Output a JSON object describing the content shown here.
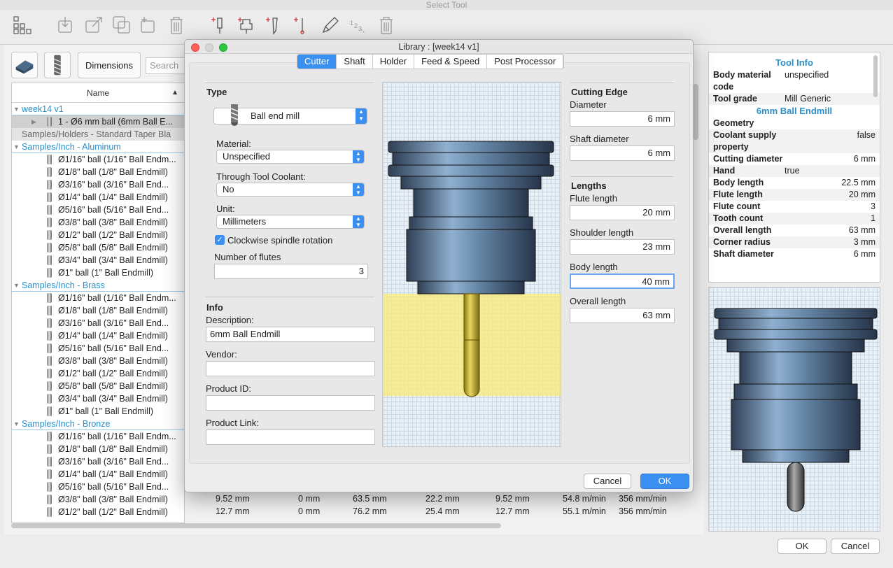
{
  "window_title": "Select Tool",
  "toolbar": {
    "icons": [
      "tool-library-icon",
      "import-icon",
      "export-icon",
      "copy-icon",
      "new-icon",
      "delete-icon",
      "new-mill-tool-icon",
      "new-holder-icon",
      "new-turning-tool-icon",
      "new-probe-icon",
      "edit-icon",
      "renumber-icon",
      "delete-tool-icon"
    ]
  },
  "left": {
    "dimensions_label": "Dimensions",
    "search_placeholder": "Search",
    "name_header": "Name",
    "tree": [
      {
        "t": "g",
        "label": "week14 v1"
      },
      {
        "t": "sel",
        "label": "1 - Ø6 mm ball (6mm Ball E..."
      },
      {
        "t": "sub",
        "label": "Samples/Holders - Standard Taper Bla"
      },
      {
        "t": "g",
        "label": "Samples/Inch - Aluminum"
      },
      {
        "t": "i",
        "label": "Ø1/16\" ball (1/16\" Ball Endm..."
      },
      {
        "t": "i",
        "label": "Ø1/8\" ball (1/8\" Ball Endmill)"
      },
      {
        "t": "i",
        "label": "Ø3/16\" ball (3/16\" Ball End..."
      },
      {
        "t": "i",
        "label": "Ø1/4\" ball (1/4\" Ball Endmill)"
      },
      {
        "t": "i",
        "label": "Ø5/16\" ball (5/16\" Ball End..."
      },
      {
        "t": "i",
        "label": "Ø3/8\" ball (3/8\" Ball Endmill)"
      },
      {
        "t": "i",
        "label": "Ø1/2\" ball (1/2\" Ball Endmill)"
      },
      {
        "t": "i",
        "label": "Ø5/8\" ball (5/8\" Ball Endmill)"
      },
      {
        "t": "i",
        "label": "Ø3/4\" ball (3/4\" Ball Endmill)"
      },
      {
        "t": "i",
        "label": "Ø1\" ball (1\" Ball Endmill)"
      },
      {
        "t": "g",
        "label": "Samples/Inch - Brass"
      },
      {
        "t": "i",
        "label": "Ø1/16\" ball (1/16\" Ball Endm..."
      },
      {
        "t": "i",
        "label": "Ø1/8\" ball (1/8\" Ball Endmill)"
      },
      {
        "t": "i",
        "label": "Ø3/16\" ball (3/16\" Ball End..."
      },
      {
        "t": "i",
        "label": "Ø1/4\" ball (1/4\" Ball Endmill)"
      },
      {
        "t": "i",
        "label": "Ø5/16\" ball (5/16\" Ball End..."
      },
      {
        "t": "i",
        "label": "Ø3/8\" ball (3/8\" Ball Endmill)"
      },
      {
        "t": "i",
        "label": "Ø1/2\" ball (1/2\" Ball Endmill)"
      },
      {
        "t": "i",
        "label": "Ø5/8\" ball (5/8\" Ball Endmill)"
      },
      {
        "t": "i",
        "label": "Ø3/4\" ball (3/4\" Ball Endmill)"
      },
      {
        "t": "i",
        "label": "Ø1\" ball (1\" Ball Endmill)"
      },
      {
        "t": "g",
        "label": "Samples/Inch - Bronze"
      },
      {
        "t": "i",
        "label": "Ø1/16\" ball (1/16\" Ball Endm..."
      },
      {
        "t": "i",
        "label": "Ø1/8\" ball (1/8\" Ball Endmill)"
      },
      {
        "t": "i",
        "label": "Ø3/16\" ball (3/16\" Ball End..."
      },
      {
        "t": "i",
        "label": "Ø1/4\" ball (1/4\" Ball Endmill)"
      },
      {
        "t": "i",
        "label": "Ø5/16\" ball (5/16\" Ball End..."
      },
      {
        "t": "i",
        "label": "Ø3/8\" ball (3/8\" Ball Endmill)"
      },
      {
        "t": "i",
        "label": "Ø1/2\" ball (1/2\" Ball Endmill)"
      }
    ],
    "bottom_rows": [
      [
        "9.52 mm",
        "0 mm",
        "63.5 mm",
        "22.2 mm",
        "9.52 mm",
        "54.8 m/min",
        "356 mm/min"
      ],
      [
        "12.7 mm",
        "0 mm",
        "76.2 mm",
        "25.4 mm",
        "12.7 mm",
        "55.1 m/min",
        "356 mm/min"
      ]
    ]
  },
  "info": {
    "title": "Tool Info",
    "title2": "6mm Ball Endmill",
    "rows_a": [
      {
        "k": "Body material code",
        "v": "unspecified"
      },
      {
        "k": "Tool grade",
        "v": "Mill Generic"
      }
    ],
    "rows_b": [
      {
        "k": "Geometry",
        "v": ""
      },
      {
        "k": "Coolant supply property",
        "v": "false"
      },
      {
        "k": "Cutting diameter",
        "v": "6 mm"
      },
      {
        "k": "Hand",
        "v": "true"
      },
      {
        "k": "Body length",
        "v": "22.5 mm"
      },
      {
        "k": "Flute length",
        "v": "20 mm"
      },
      {
        "k": "Flute count",
        "v": "3"
      },
      {
        "k": "Tooth count",
        "v": "1"
      },
      {
        "k": "Overall length",
        "v": "63 mm"
      },
      {
        "k": "Corner radius",
        "v": "3 mm"
      },
      {
        "k": "Shaft diameter",
        "v": "6 mm"
      }
    ]
  },
  "footer": {
    "ok": "OK",
    "cancel": "Cancel"
  },
  "dialog": {
    "title": "Library :  [week14 v1]",
    "tabs": [
      "Cutter",
      "Shaft",
      "Holder",
      "Feed & Speed",
      "Post Processor"
    ],
    "type_heading": "Type",
    "type_value": "Ball end mill",
    "material_label": "Material:",
    "material_value": "Unspecified",
    "coolant_label": "Through Tool Coolant:",
    "coolant_value": "No",
    "unit_label": "Unit:",
    "unit_value": "Millimeters",
    "cw_label": "Clockwise spindle rotation",
    "flutes_label": "Number of flutes",
    "flutes_value": "3",
    "info_heading": "Info",
    "desc_label": "Description:",
    "desc_value": "6mm Ball Endmill",
    "vendor_label": "Vendor:",
    "vendor_value": "",
    "pid_label": "Product ID:",
    "pid_value": "",
    "plink_label": "Product Link:",
    "plink_value": "",
    "edge_heading": "Cutting Edge",
    "diameter_label": "Diameter",
    "diameter_value": "6 mm",
    "shaftd_label": "Shaft diameter",
    "shaftd_value": "6 mm",
    "lengths_heading": "Lengths",
    "flute_label": "Flute length",
    "flute_value": "20 mm",
    "shoulder_label": "Shoulder length",
    "shoulder_value": "23 mm",
    "body_label": "Body length",
    "body_value": "40 mm",
    "overall_label": "Overall length",
    "overall_value": "63 mm",
    "cancel": "Cancel",
    "ok": "OK"
  }
}
